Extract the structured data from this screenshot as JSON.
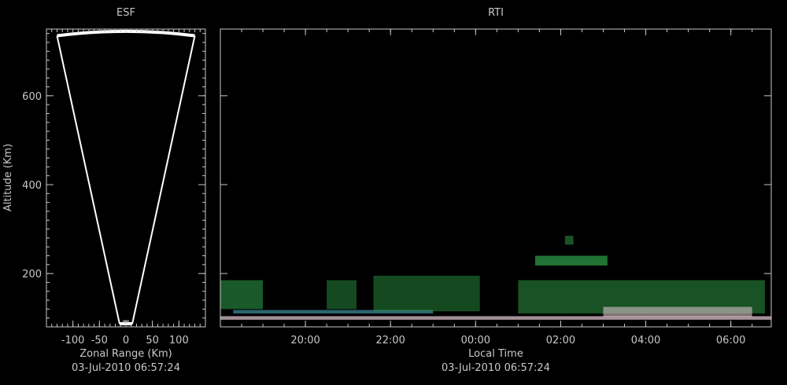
{
  "colors": {
    "background": "#000000",
    "text": "#c8c8c8",
    "frame": "#c8c8c8",
    "echo_green": "#2fa34a",
    "echo_pink": "#d8c0c8",
    "echo_cyan": "#4fb6c6",
    "beam_outline": "#ffffff"
  },
  "chart_data": [
    {
      "type": "heatmap",
      "title": "ESF",
      "xlabel": "Zonal Range (Km)",
      "ylabel": "Altitude (Km)",
      "footer": "03-Jul-2010 06:57:24",
      "xlim": [
        -150,
        150
      ],
      "ylim": [
        80,
        750
      ],
      "x_ticks": [
        -100,
        -50,
        0,
        50,
        100
      ],
      "x_tick_labels": [
        "-100",
        "-50",
        "0",
        "50",
        "100"
      ],
      "y_ticks": [
        200,
        400,
        600
      ],
      "y_tick_labels": [
        "200",
        "400",
        "600"
      ],
      "beam_outline": {
        "apex_left": [
          -12,
          87
        ],
        "apex_right": [
          12,
          87
        ],
        "top_left": [
          -130,
          735
        ],
        "top_right": [
          130,
          735
        ],
        "top_arc_peak_alt": 745
      },
      "echoes": [
        {
          "x": 0,
          "alt": 88,
          "intensity": 0.8
        }
      ]
    },
    {
      "type": "heatmap",
      "title": "RTI",
      "xlabel": "Local Time",
      "ylabel": "",
      "footer": "03-Jul-2010 06:57:24",
      "xlim": [
        18.0,
        30.95
      ],
      "ylim": [
        80,
        750
      ],
      "x_ticks": [
        20,
        22,
        24,
        26,
        28,
        30
      ],
      "x_tick_labels": [
        "20:00",
        "22:00",
        "00:00",
        "02:00",
        "04:00",
        "06:00"
      ],
      "y_ticks": [
        200,
        400,
        600
      ],
      "echo_layers": [
        {
          "t_start": 18.0,
          "t_end": 30.95,
          "alt_low": 96,
          "alt_high": 104,
          "color": "pink",
          "intensity": 0.75
        },
        {
          "t_start": 18.3,
          "t_end": 23.0,
          "alt_low": 110,
          "alt_high": 118,
          "color": "cyan",
          "intensity": 0.55
        },
        {
          "t_start": 18.0,
          "t_end": 19.0,
          "alt_low": 120,
          "alt_high": 185,
          "color": "green",
          "intensity": 0.55
        },
        {
          "t_start": 20.5,
          "t_end": 21.2,
          "alt_low": 120,
          "alt_high": 185,
          "color": "green",
          "intensity": 0.45
        },
        {
          "t_start": 21.6,
          "t_end": 24.1,
          "alt_low": 115,
          "alt_high": 195,
          "color": "green",
          "intensity": 0.45
        },
        {
          "t_start": 25.0,
          "t_end": 30.8,
          "alt_low": 110,
          "alt_high": 185,
          "color": "green",
          "intensity": 0.5
        },
        {
          "t_start": 27.0,
          "t_end": 30.5,
          "alt_low": 102,
          "alt_high": 125,
          "color": "pink",
          "intensity": 0.6
        },
        {
          "t_start": 25.4,
          "t_end": 27.1,
          "alt_low": 218,
          "alt_high": 240,
          "color": "green",
          "intensity": 0.7
        },
        {
          "t_start": 26.1,
          "t_end": 26.3,
          "alt_low": 265,
          "alt_high": 285,
          "color": "green",
          "intensity": 0.5
        }
      ]
    }
  ]
}
